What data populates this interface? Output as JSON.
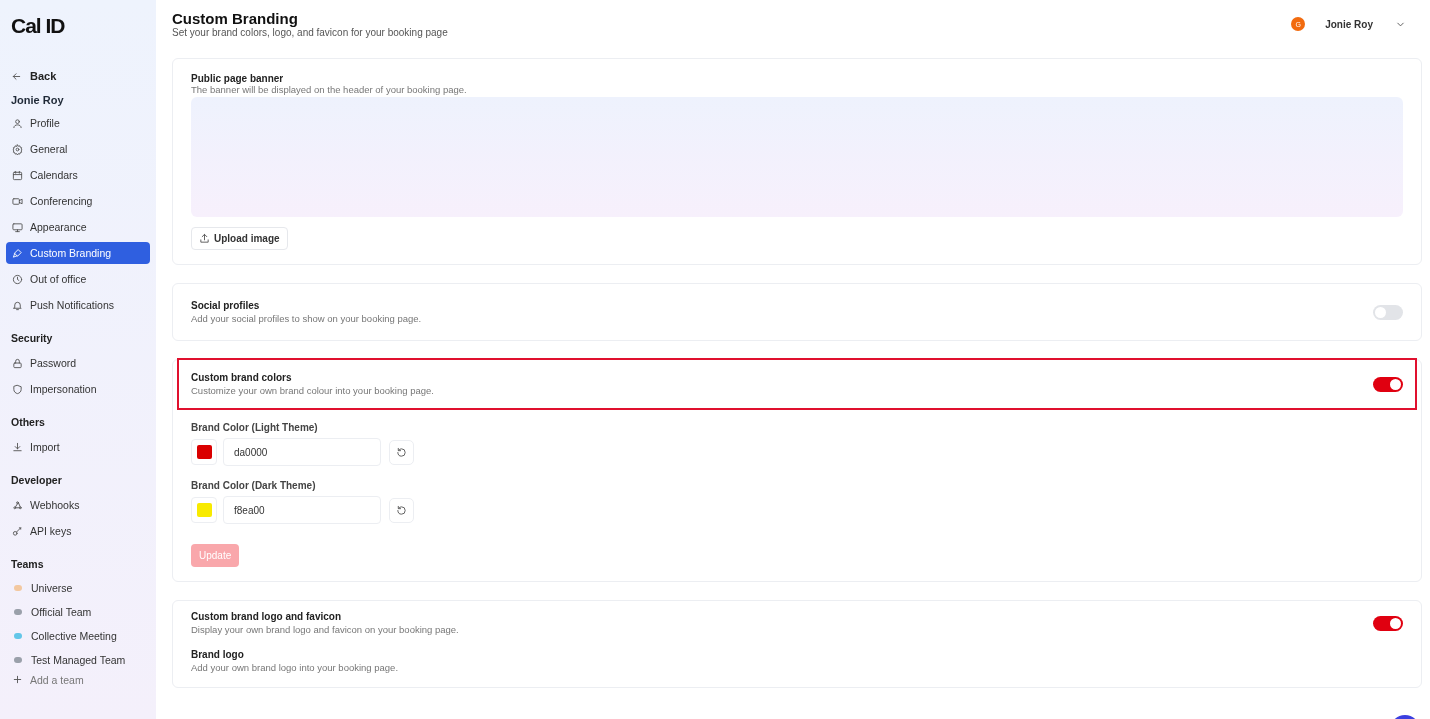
{
  "sidebar": {
    "logo": "Cal ID",
    "back": "Back",
    "user": "Jonie Roy",
    "sections": [
      {
        "items": [
          {
            "label": "Profile",
            "selected": false
          },
          {
            "label": "General",
            "selected": false
          },
          {
            "label": "Calendars",
            "selected": false
          },
          {
            "label": "Conferencing",
            "selected": false
          },
          {
            "label": "Appearance",
            "selected": false
          },
          {
            "label": "Custom Branding",
            "selected": true
          },
          {
            "label": "Out of office",
            "selected": false
          },
          {
            "label": "Push Notifications",
            "selected": false
          }
        ]
      },
      {
        "heading": "Security",
        "items": [
          {
            "label": "Password",
            "selected": false
          },
          {
            "label": "Impersonation",
            "selected": false
          }
        ]
      },
      {
        "heading": "Others",
        "items": [
          {
            "label": "Import",
            "selected": false
          }
        ]
      },
      {
        "heading": "Developer",
        "items": [
          {
            "label": "Webhooks",
            "selected": false
          },
          {
            "label": "API keys",
            "selected": false
          }
        ]
      },
      {
        "heading": "Teams",
        "items": [
          {
            "label": "Universe",
            "kind": "team",
            "selected": false
          },
          {
            "label": "Official Team",
            "kind": "team",
            "selected": false
          },
          {
            "label": "Collective Meeting",
            "kind": "team",
            "selected": false
          },
          {
            "label": "Test Managed Team",
            "kind": "team",
            "selected": false
          },
          {
            "label": "Add a team",
            "kind": "add",
            "selected": false
          }
        ]
      }
    ]
  },
  "header": {
    "title": "Custom Branding",
    "subtitle": "Set your brand colors, logo, and favicon for your booking page",
    "user": {
      "initial": "G",
      "name": "Jonie Roy"
    }
  },
  "cards": [
    {
      "kind": "banner",
      "title": "Public page banner",
      "description": "The banner will be displayed on the header of your booking page.",
      "button": "Upload image"
    },
    {
      "kind": "toggle",
      "title": "Social profiles",
      "description": "Add your social profiles to show on your booking page.",
      "on": false,
      "highlighted": false
    },
    {
      "kind": "colors",
      "title": "Custom brand colors",
      "description": "Customize your own brand colour into your booking page.",
      "on": true,
      "highlighted": true,
      "fields": [
        {
          "label": "Brand Color (Light Theme)",
          "value": "da0000",
          "color": "#da0000"
        },
        {
          "label": "Brand Color (Dark Theme)",
          "value": "f8ea00",
          "color": "#f8ea00"
        }
      ],
      "button": {
        "label": "Update",
        "disabled": true
      }
    },
    {
      "kind": "logo",
      "title": "Custom brand logo and favicon",
      "description": "Display your own brand logo and favicon on your booking page.",
      "on": true,
      "highlighted": false,
      "sub": {
        "title": "Brand logo",
        "description": "Add your own brand logo into your booking page."
      }
    }
  ]
}
